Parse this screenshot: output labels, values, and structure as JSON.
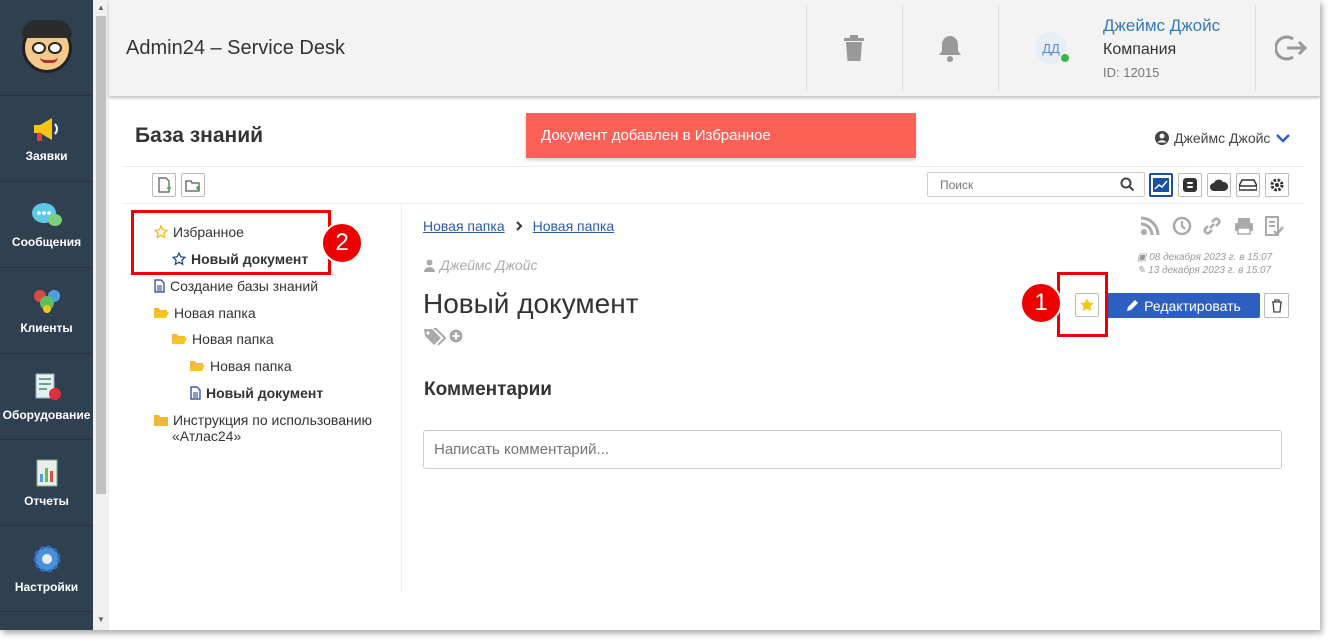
{
  "app": {
    "title": "Admin24 – Service Desk"
  },
  "sidebar": {
    "items": [
      {
        "label": "Заявки",
        "icon": "megaphone-icon"
      },
      {
        "label": "Сообщения",
        "icon": "chat-bubble-icon"
      },
      {
        "label": "Клиенты",
        "icon": "users-icon"
      },
      {
        "label": "Оборудование",
        "icon": "equipment-icon"
      },
      {
        "label": "Отчеты",
        "icon": "report-icon"
      },
      {
        "label": "Настройки",
        "icon": "gear-icon"
      }
    ]
  },
  "user": {
    "initials": "ДД",
    "name": "Джеймс Джойс",
    "company": "Компания",
    "id": "ID: 12015"
  },
  "page": {
    "title": "База знаний",
    "header_user": "Джеймс Джойс"
  },
  "toast": {
    "text": "Документ добавлен в Избранное",
    "color": "#fb6157"
  },
  "search": {
    "placeholder": "Поиск"
  },
  "tree": {
    "favorites": "Избранное",
    "fav_doc": "Новый документ",
    "item1": "Создание базы знаний",
    "folder1": "Новая папка",
    "folder2": "Новая папка",
    "folder3": "Новая папка",
    "doc": "Новый документ",
    "instr1": "Инструкция по использованию",
    "instr2": "«Атлас24»"
  },
  "breadcrumb": [
    "Новая папка",
    "Новая папка"
  ],
  "document": {
    "author": "Джеймс Джойс",
    "created": "08 декабря 2023 г. в 15:07",
    "modified": "13 декабря 2023 г. в 15:07",
    "title": "Новый документ",
    "edit_label": "Редактировать"
  },
  "comments": {
    "heading": "Комментарии",
    "placeholder": "Написать комментарий..."
  },
  "annotations": {
    "one": "1",
    "two": "2"
  },
  "colors": {
    "sidebar": "#2f4050",
    "accent": "#2d5fbf",
    "link": "#2a5caa",
    "annotation": "#e00000",
    "star": "#f5c518"
  }
}
